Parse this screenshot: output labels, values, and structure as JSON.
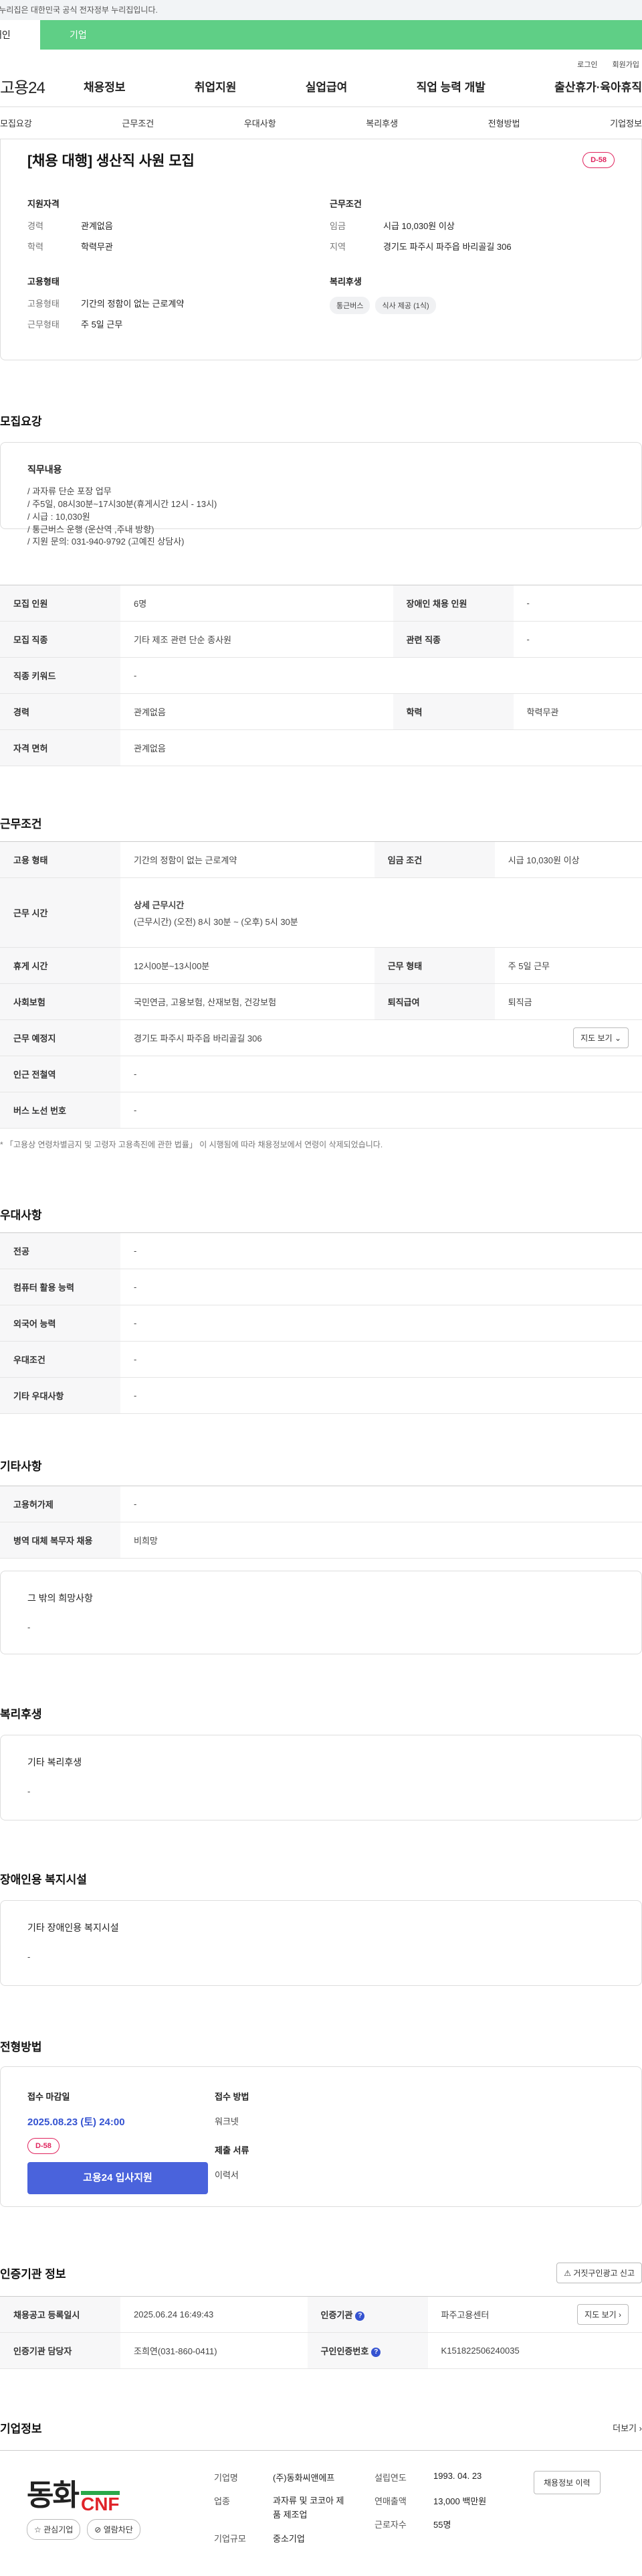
{
  "topbar": {
    "notice": "이 누리집은 대한민국 공식 전자정부 누리집입니다."
  },
  "usertype": {
    "personal": "개인",
    "company": "기업"
  },
  "header_links": {
    "login": "로그인",
    "join": "회원가입"
  },
  "logo": "고용24",
  "gnb": [
    "채용정보",
    "취업지원",
    "실업급여",
    "직업 능력 개발",
    "출산휴가·육아휴직"
  ],
  "tabs": [
    "모집요강",
    "근무조건",
    "우대사항",
    "복리후생",
    "전형방법",
    "기업정보"
  ],
  "summary": {
    "title": "[채용 대행] 생산직 사원 모집",
    "dday": "D-58",
    "qual_title": "지원자격",
    "qual": [
      {
        "k": "경력",
        "v": "관계없음"
      },
      {
        "k": "학력",
        "v": "학력무관"
      }
    ],
    "cond_title": "근무조건",
    "cond": [
      {
        "k": "임금",
        "v": "시급 10,030원 이상"
      },
      {
        "k": "지역",
        "v": "경기도 파주시 파주읍 바리골길 306"
      }
    ],
    "emp_title": "고용형태",
    "emp": [
      {
        "k": "고용형태",
        "v": "기간의 정함이 없는 근로계약"
      },
      {
        "k": "근무형태",
        "v": "주 5일 근무"
      }
    ],
    "welfare_title": "복리후생",
    "welfare_chips": [
      "통근버스",
      "식사 제공 (1식)"
    ]
  },
  "recruit": {
    "title": "모집요강",
    "duty_title": "직무내용",
    "duty_lines": [
      "/ 과자류 단순 포장 업무",
      "/ 주5일,  08시30분~17시30분(휴게시간 12시 - 13시)",
      "/ 시급 : 10,030원",
      "/ 통근버스 운행 (운산역 ,주내 방향)",
      "/ 지원 문의: 031-940-9792 (고예진 상담사)"
    ],
    "rows": [
      {
        "k1": "모집 인원",
        "v1": "6명",
        "k2": "장애인 채용 인원",
        "v2": "-"
      },
      {
        "k1": "모집 직종",
        "v1": "기타 제조 관련 단순 종사원",
        "k2": "관련 직종",
        "v2": "-"
      },
      {
        "k1": "직종 키워드",
        "v1": "-"
      },
      {
        "k1": "경력",
        "v1": "관계없음",
        "k2": "학력",
        "v2": "학력무관"
      },
      {
        "k1": "자격 면허",
        "v1": "관계없음"
      }
    ]
  },
  "work": {
    "title": "근무조건",
    "emp_k": "고용 형태",
    "emp_v": "기간의 정함이 없는 근로계약",
    "wage_k": "임금 조건",
    "wage_v": "시급 10,030원 이상",
    "time_k": "근무 시간",
    "time_h": "상세 근무시간",
    "time_v": "(근무시간) (오전) 8시 30분 ~ (오후) 5시 30분",
    "rest_k": "휴게 시간",
    "rest_v": "12시00분~13시00분",
    "form_k": "근무 형태",
    "form_v": "주 5일 근무",
    "ins_k": "사회보험",
    "ins_v": "국민연금, 고용보험, 산재보험, 건강보험",
    "sev_k": "퇴직급여",
    "sev_v": "퇴직금",
    "place_k": "근무 예정지",
    "place_v": "경기도 파주시 파주읍 바리골길 306",
    "map_btn": "지도 보기",
    "subway_k": "인근 전철역",
    "subway_v": "-",
    "bus_k": "버스 노선 번호",
    "bus_v": "-",
    "note": "* 「고용상 연령차별금지 및 고령자 고용촉진에 관한 법률」 이 시행됨에 따라 채용정보에서 연령이 삭제되었습니다."
  },
  "pref": {
    "title": "우대사항",
    "rows": [
      {
        "k": "전공",
        "v": "-"
      },
      {
        "k": "컴퓨터 활용 능력",
        "v": "-"
      },
      {
        "k": "외국어 능력",
        "v": "-"
      },
      {
        "k": "우대조건",
        "v": "-"
      },
      {
        "k": "기타 우대사항",
        "v": "-"
      }
    ]
  },
  "etc": {
    "title": "기타사항",
    "rows": [
      {
        "k": "고용허가제",
        "v": "-"
      },
      {
        "k": "병역 대체 복무자 채용",
        "v": "비희망"
      }
    ],
    "other_h": "그 밖의 희망사항",
    "other_v": "-"
  },
  "welfare": {
    "title": "복리후생",
    "h": "기타 복리후생",
    "v": "-"
  },
  "disabled": {
    "title": "장애인용 복지시설",
    "h": "기타 장애인용 복지시설",
    "v": "-"
  },
  "selection": {
    "title": "전형방법",
    "deadline_h": "접수 마감일",
    "deadline_v": "2025.08.23 (토) 24:00",
    "dday": "D-58",
    "apply_btn": "고용24 입사지원",
    "method_h": "접수 방법",
    "method_v": "워크넷",
    "docs_h": "제출 서류",
    "docs_v": "이력서"
  },
  "agency": {
    "title": "인증기관 정보",
    "report_btn": "거짓구인광고 신고",
    "reg_k": "채용공고 등록일시",
    "reg_v": "2025.06.24 16:49:43",
    "org_k": "인증기관",
    "org_v": "파주고용센터",
    "map_btn": "지도 보기",
    "mgr_k": "인증기관 담당자",
    "mgr_v": "조희연(031-860-0411)",
    "id_k": "구인인증번호",
    "id_v": "K151822506240035"
  },
  "company": {
    "title": "기업정보",
    "more": "더보기",
    "logo_ko": "동화",
    "logo_en": "CNF",
    "fav_btn": "관심기업",
    "block_btn": "열람차단",
    "rows": [
      {
        "k": "기업명",
        "v": "(주)동화씨앤에프"
      },
      {
        "k": "업종",
        "v": "과자류 및 코코아 제품 제조업"
      },
      {
        "k": "기업규모",
        "v": "중소기업"
      }
    ],
    "rows2": [
      {
        "k": "설립연도",
        "v": "1993. 04. 23"
      },
      {
        "k": "연매출액",
        "v": "13,000 백만원"
      },
      {
        "k": "근로자수",
        "v": "55명"
      }
    ],
    "history_btn": "채용정보 이력"
  },
  "colors": {
    "accent": "#4a63dc",
    "green": "#5fcf86",
    "dday": "#e0245e"
  }
}
